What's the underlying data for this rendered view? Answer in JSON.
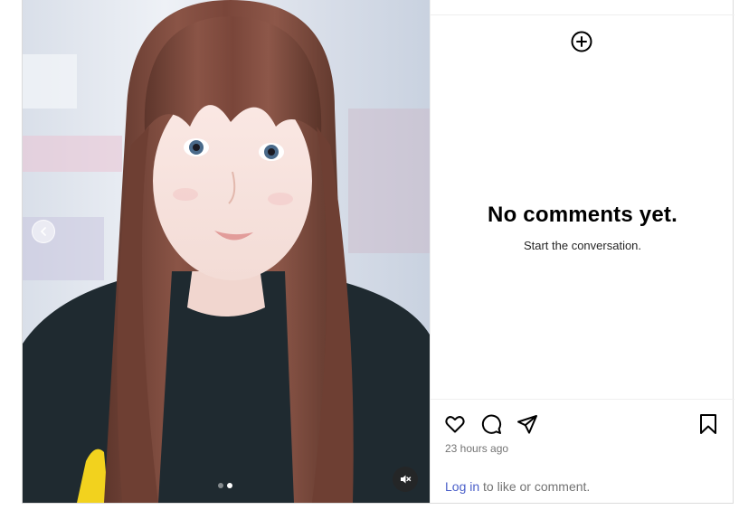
{
  "comments": {
    "empty_title": "No comments yet.",
    "empty_subtitle": "Start the conversation."
  },
  "post": {
    "timestamp": "23 hours ago",
    "login_link": "Log in",
    "login_suffix": " to like or comment."
  },
  "carousel": {
    "slide_count": 2,
    "active_slide": 2
  },
  "icons": {
    "add": "plus-circle-icon",
    "like": "heart-icon",
    "comment": "comment-bubble-icon",
    "share": "paper-plane-icon",
    "save": "bookmark-icon",
    "prev": "chevron-left-icon",
    "mute": "speaker-muted-icon"
  },
  "colors": {
    "link": "#4a5fc9",
    "muted_text": "#737373",
    "border": "#dbdbdb"
  }
}
